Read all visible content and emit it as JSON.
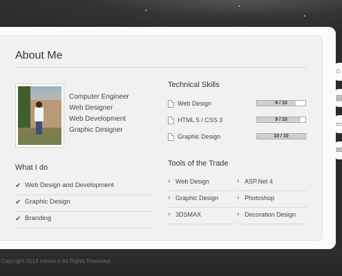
{
  "about": {
    "title": "About Me",
    "roles": [
      "Computer Engineer",
      "Web Designer",
      "Web Development",
      "Graphic Designer"
    ]
  },
  "what_i_do": {
    "title": "What I do",
    "items": [
      "Web Design and Development",
      "Graphic Design",
      "Branding"
    ]
  },
  "technical_skills": {
    "title": "Technical Skills",
    "items": [
      {
        "name": "Web Design",
        "score": "8 / 10",
        "value": 8
      },
      {
        "name": "HTML 5 / CSS 3",
        "score": "9 / 10",
        "value": 9
      },
      {
        "name": "Graphic Design",
        "score": "10 / 10",
        "value": 10
      }
    ]
  },
  "tools": {
    "title": "Tools of the Trade",
    "left": [
      "Web Design",
      "Graphic Design",
      "3DSMAX"
    ],
    "right": [
      "ASP.Net 4",
      "Photoshop",
      "Decoration Design"
    ]
  },
  "side_nav": {
    "icons": [
      "home-icon",
      "document-icon",
      "monitor-icon",
      "mail-icon"
    ]
  },
  "footer": {
    "copyright": "Copyright 2013 mtoosi.ir All Rights Reserved."
  },
  "colors": {
    "background": "#2b2b2b",
    "panel": "#fbfbfb",
    "card": "#f1f1f1",
    "text": "#444444"
  }
}
